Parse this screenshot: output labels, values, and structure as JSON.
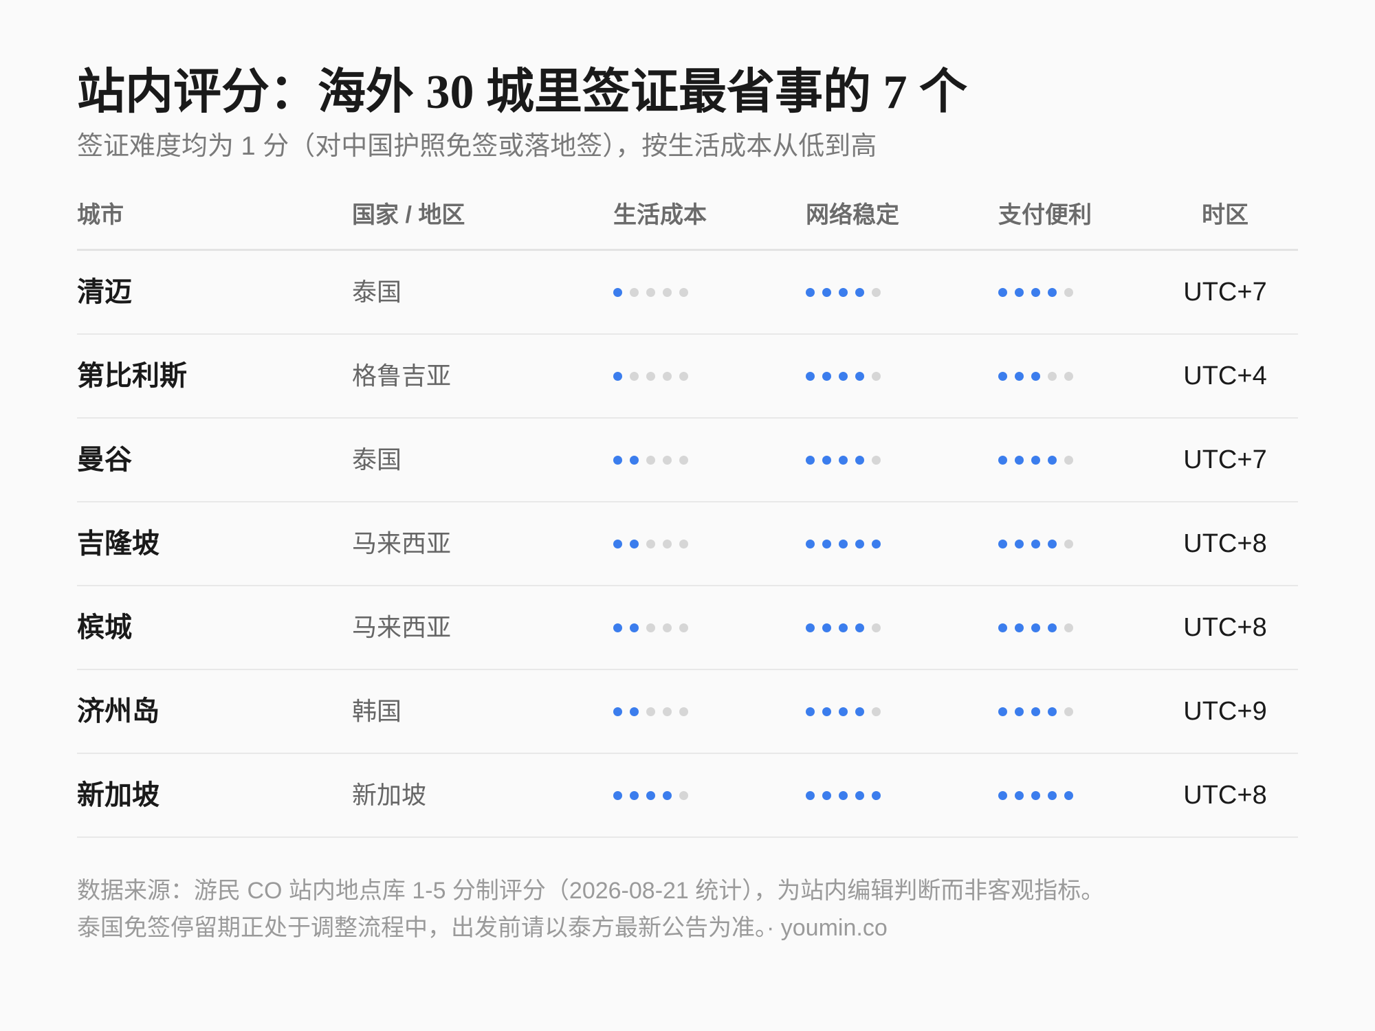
{
  "header": {
    "title": "站内评分：海外 30 城里签证最省事的 7 个",
    "subtitle": "签证难度均为 1 分（对中国护照免签或落地签），按生活成本从低到高"
  },
  "colors": {
    "dot_active": "#3b7ded",
    "dot_inactive": "#d6d6d6"
  },
  "chart_data": {
    "type": "table",
    "max_score": 5,
    "columns": {
      "city": "城市",
      "country": "国家 / 地区",
      "cost": "生活成本",
      "network": "网络稳定",
      "payment": "支付便利",
      "timezone": "时区"
    },
    "rows": [
      {
        "city": "清迈",
        "country": "泰国",
        "cost": 1,
        "network": 4,
        "payment": 4,
        "timezone": "UTC+7"
      },
      {
        "city": "第比利斯",
        "country": "格鲁吉亚",
        "cost": 1,
        "network": 4,
        "payment": 3,
        "timezone": "UTC+4"
      },
      {
        "city": "曼谷",
        "country": "泰国",
        "cost": 2,
        "network": 4,
        "payment": 4,
        "timezone": "UTC+7"
      },
      {
        "city": "吉隆坡",
        "country": "马来西亚",
        "cost": 2,
        "network": 5,
        "payment": 4,
        "timezone": "UTC+8"
      },
      {
        "city": "槟城",
        "country": "马来西亚",
        "cost": 2,
        "network": 4,
        "payment": 4,
        "timezone": "UTC+8"
      },
      {
        "city": "济州岛",
        "country": "韩国",
        "cost": 2,
        "network": 4,
        "payment": 4,
        "timezone": "UTC+9"
      },
      {
        "city": "新加坡",
        "country": "新加坡",
        "cost": 4,
        "network": 5,
        "payment": 5,
        "timezone": "UTC+8"
      }
    ]
  },
  "footer": {
    "line1": "数据来源：游民 CO 站内地点库 1-5 分制评分（2026-08-21 统计），为站内编辑判断而非客观指标。",
    "line2": "泰国免签停留期正处于调整流程中，出发前请以泰方最新公告为准。· youmin.co"
  }
}
